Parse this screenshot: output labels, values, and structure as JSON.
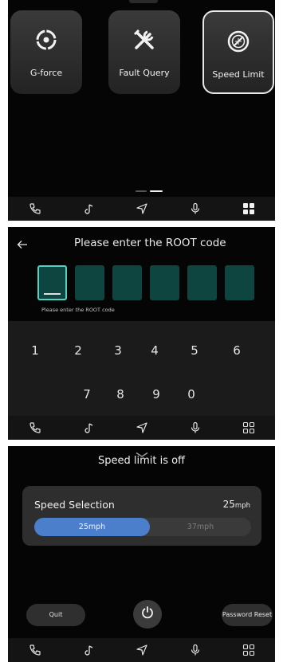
{
  "apps_screen": {
    "tiles": [
      {
        "label": "G-force",
        "icon": "target-icon"
      },
      {
        "label": "Fault Query",
        "icon": "tools-icon"
      },
      {
        "label": "Speed Limit",
        "icon": "speed-limit-icon",
        "selected": true
      }
    ],
    "page_indicator": {
      "pages": 2,
      "current": 2
    }
  },
  "root_screen": {
    "title": "Please enter the ROOT code",
    "hint": "Please enter the ROOT code",
    "code_length": 6,
    "keys": [
      "1",
      "2",
      "3",
      "4",
      "5",
      "6",
      "7",
      "8",
      "9",
      "0"
    ]
  },
  "speed_screen": {
    "status": "Speed limit is off",
    "selection_label": "Speed Selection",
    "selection_value": "25",
    "selection_unit": "mph",
    "options": [
      "25mph",
      "37mph"
    ],
    "selected_option": "25mph",
    "quit_label": "Quit",
    "password_reset_label": "Password Reset"
  },
  "dock_icons": [
    "phone-icon",
    "music-icon",
    "navigation-icon",
    "microphone-icon",
    "apps-grid-icon"
  ],
  "colors": {
    "accent_teal": "#4fd3c4",
    "code_box": "#0f4540",
    "selected_blue": "#4b7fcc",
    "background": "#050505"
  }
}
